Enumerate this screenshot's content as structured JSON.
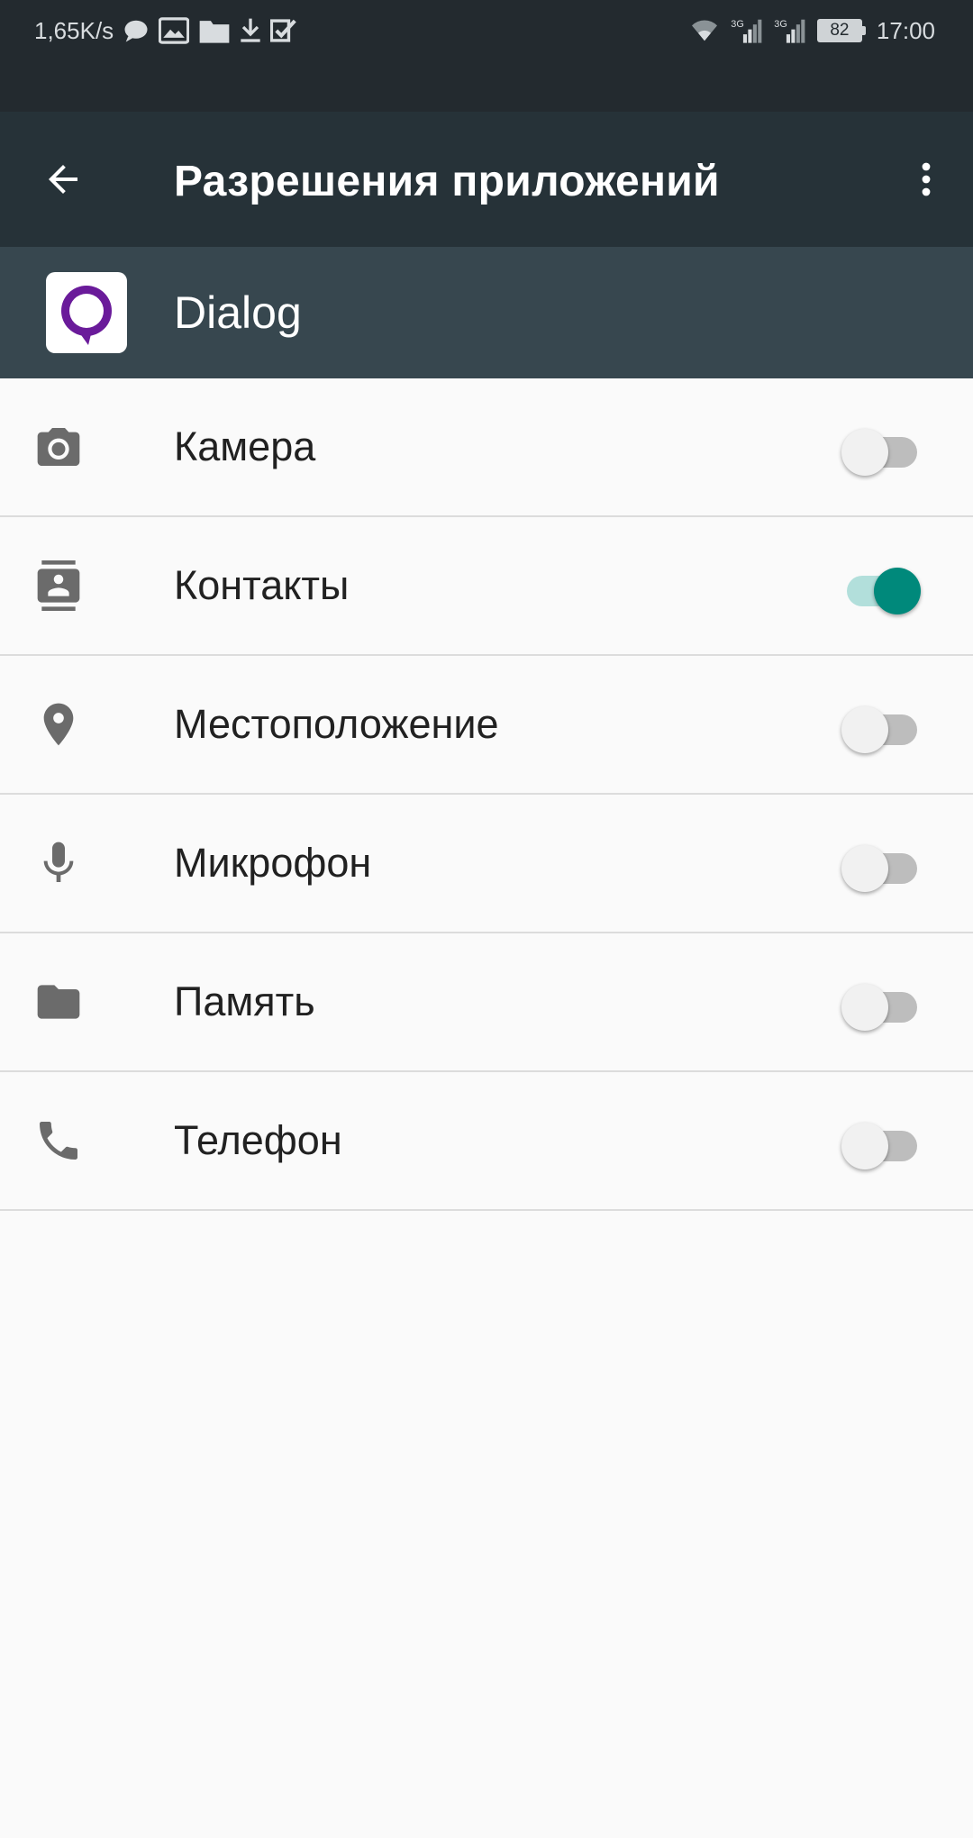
{
  "status_bar": {
    "net_speed": "1,65K/s",
    "battery": "82",
    "time": "17:00",
    "left_icons": [
      "chat-bubble-icon",
      "image-icon",
      "folder-icon",
      "download-icon",
      "check-icon"
    ],
    "right_icons": [
      "wifi-icon",
      "signal-3g-icon",
      "signal-3g-icon",
      "battery-icon"
    ]
  },
  "toolbar": {
    "title": "Разрешения приложений",
    "back_icon": "arrow-back-icon",
    "more_icon": "more-vert-icon"
  },
  "app": {
    "name": "Dialog",
    "icon_color": "#6a1b9a"
  },
  "permissions": [
    {
      "label": "Камера",
      "icon": "camera-icon",
      "enabled": false
    },
    {
      "label": "Контакты",
      "icon": "contacts-icon",
      "enabled": true
    },
    {
      "label": "Местоположение",
      "icon": "location-icon",
      "enabled": false
    },
    {
      "label": "Микрофон",
      "icon": "microphone-icon",
      "enabled": false
    },
    {
      "label": "Память",
      "icon": "folder-icon",
      "enabled": false
    },
    {
      "label": "Телефон",
      "icon": "phone-icon",
      "enabled": false
    }
  ],
  "colors": {
    "status_bar_bg": "#232a2f",
    "toolbar_bg": "#263238",
    "app_header_bg": "#37474f",
    "switch_on": "#00897b",
    "switch_on_track": "#b2dfdb",
    "switch_off_track": "#bdbdbd",
    "page_bg": "#fafafa"
  }
}
